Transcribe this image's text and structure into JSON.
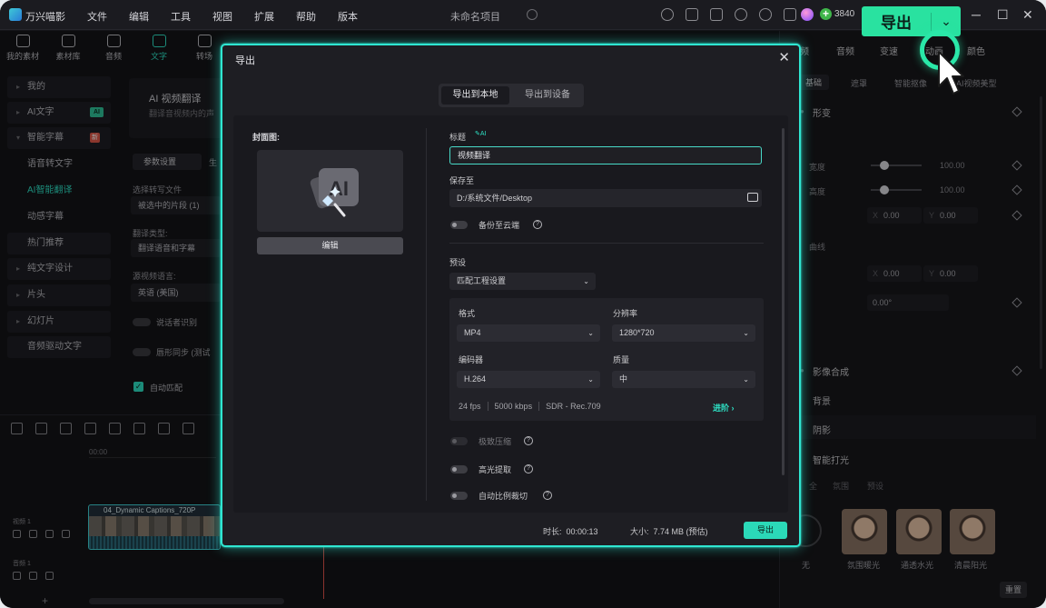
{
  "app": {
    "name": "万兴喵影",
    "menu": [
      "文件",
      "编辑",
      "工具",
      "视图",
      "扩展",
      "帮助",
      "版本"
    ],
    "project_title": "未命名项目",
    "credits": "3840",
    "export_button": "导出"
  },
  "toolbar": [
    "我的素材",
    "素材库",
    "音频",
    "文字",
    "转场"
  ],
  "left_panel": [
    "我的",
    "AI文字",
    "智能字幕",
    "语音转文字",
    "AI智能翻译",
    "动感字幕",
    "热门推荐",
    "纯文字设计",
    "片头",
    "幻灯片",
    "音频驱动文字"
  ],
  "left_badges": {
    "ai": "AI",
    "new": "新"
  },
  "mid_panel": {
    "card_title": "AI 视频翻译",
    "card_sub": "翻译音视频内的声",
    "tab1": "参数设置",
    "tab2": "生",
    "field1_label": "选择转写文件",
    "field1_value": "被选中的片段 (1)",
    "field2_label": "翻译类型:",
    "field2_value": "翻译语音和字幕",
    "field3_label": "源视频语言:",
    "field3_value": "英语 (美国)",
    "toggle1": "说话者识别",
    "toggle2": "唇形同步 (测试",
    "check": "自动匹配"
  },
  "timeline": {
    "time": "00:00",
    "video_track": "视频 1",
    "audio_track": "音频 1",
    "clip_name": "04_Dynamic Captions_720P",
    "plus": "+"
  },
  "right_panel": {
    "tabs": [
      "频",
      "音频",
      "变速",
      "动画",
      "颜色"
    ],
    "subtabs": [
      "基础",
      "遮罩",
      "智能抠像",
      "AI视频美型"
    ],
    "transform": "形变",
    "width_label": "宽度",
    "height_label": "高度",
    "width_val": "100.00",
    "height_val": "100.00",
    "pos_x": "0.00",
    "pos_y": "0.00",
    "curve": "曲线",
    "anchor_x": "0.00",
    "anchor_y": "0.00",
    "rotation": "0.00°",
    "composite": "影像合成",
    "background": "背景",
    "shadow": "阴影",
    "smart_light": "智能打光",
    "preset_tabs": [
      "全",
      "氛围",
      "预设"
    ],
    "presets": [
      "无",
      "氛围暖光",
      "通透水光",
      "清晨阳光"
    ],
    "reset": "重置"
  },
  "export_dialog": {
    "title": "导出",
    "tab_local": "导出到本地",
    "tab_device": "导出到设备",
    "cover_label": "封面图:",
    "cover_ai_text": "AI",
    "edit_button": "编辑",
    "title_label": "标题",
    "title_ai": "AI",
    "title_value": "视频翻译",
    "save_to_label": "保存至",
    "save_path": "D:/系统文件/Desktop",
    "backup_label": "备份至云端",
    "preset_label": "预设",
    "preset_value": "匹配工程设置",
    "format_label": "格式",
    "format_value": "MP4",
    "resolution_label": "分辨率",
    "resolution_value": "1280*720",
    "encoder_label": "编码器",
    "encoder_value": "H.264",
    "quality_label": "质量",
    "quality_value": "中",
    "fps": "24 fps",
    "bitrate": "5000 kbps",
    "color": "SDR - Rec.709",
    "advanced": "进阶",
    "compress_label": "极致压缩",
    "highlight_label": "高光提取",
    "autocrop_label": "自动比例裁切",
    "duration_label": "时长:",
    "duration_value": "00:00:13",
    "size_label": "大小:",
    "size_value": "7.74 MB (预估)",
    "export_button": "导出"
  },
  "colors": {
    "accent": "#2ee0c4",
    "export_green": "#29e2a0",
    "dialog_border": "#2fe6d1"
  }
}
